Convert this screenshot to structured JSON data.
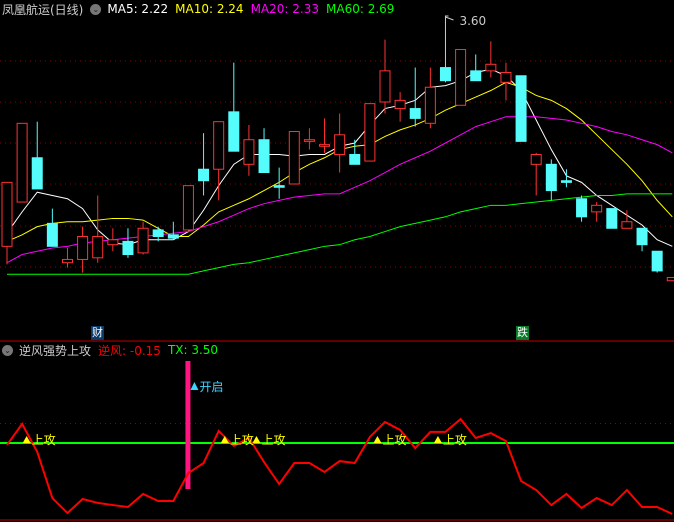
{
  "header": {
    "stock_title": "凤凰航运(日线)",
    "ma5": "MA5: 2.22",
    "ma10": "MA10: 2.24",
    "ma20": "MA20: 2.33",
    "ma60": "MA60: 2.69",
    "collapse_icon": "chevron-down-icon"
  },
  "high_marker": "3.60",
  "event_tags": {
    "cai": "财",
    "die": "跌"
  },
  "indicator": {
    "title": "逆风强势上攻",
    "nifeng": "逆风: -0.15",
    "tx": "TX: 3.50",
    "open_signal_label": "开启",
    "attack_label": "上攻"
  },
  "colors": {
    "up": "#ff3232",
    "down": "#54fcfc",
    "ma5": "#ffffff",
    "ma10": "#ffff00",
    "ma20": "#ff00ff",
    "ma60": "#00ff00",
    "grid": "#8b0000",
    "signal_bar": "#ff1480",
    "nifeng_line": "#ff0000",
    "tx_line": "#00ff00"
  },
  "chart_data": [
    {
      "type": "candlestick",
      "title": "凤凰航运(日线)",
      "ohlc": [
        [
          2.22,
          2.61,
          2.11,
          2.61
        ],
        [
          2.49,
          2.97,
          2.49,
          2.97
        ],
        [
          2.76,
          2.98,
          2.57,
          2.57
        ],
        [
          2.36,
          2.45,
          2.22,
          2.22
        ],
        [
          2.12,
          2.21,
          2.09,
          2.14
        ],
        [
          2.14,
          2.34,
          2.06,
          2.28
        ],
        [
          2.15,
          2.53,
          2.12,
          2.28
        ],
        [
          2.23,
          2.33,
          2.19,
          2.26
        ],
        [
          2.25,
          2.33,
          2.15,
          2.17
        ],
        [
          2.18,
          2.37,
          2.17,
          2.33
        ],
        [
          2.32,
          2.34,
          2.25,
          2.28
        ],
        [
          2.29,
          2.37,
          2.26,
          2.27
        ],
        [
          2.32,
          2.59,
          2.32,
          2.59
        ],
        [
          2.69,
          2.91,
          2.53,
          2.62
        ],
        [
          2.69,
          2.98,
          2.5,
          2.98
        ],
        [
          3.04,
          3.34,
          2.8,
          2.8
        ],
        [
          2.72,
          2.96,
          2.65,
          2.87
        ],
        [
          2.87,
          2.94,
          2.67,
          2.67
        ],
        [
          2.59,
          2.7,
          2.51,
          2.58
        ],
        [
          2.6,
          2.92,
          2.6,
          2.92
        ],
        [
          2.86,
          2.94,
          2.81,
          2.87
        ],
        [
          2.83,
          3.0,
          2.79,
          2.84
        ],
        [
          2.78,
          3.03,
          2.67,
          2.9
        ],
        [
          2.78,
          2.87,
          2.72,
          2.72
        ],
        [
          2.74,
          3.09,
          2.74,
          3.09
        ],
        [
          3.1,
          3.48,
          3.03,
          3.29
        ],
        [
          3.06,
          3.16,
          2.98,
          3.11
        ],
        [
          3.06,
          3.31,
          2.95,
          3.0
        ],
        [
          2.97,
          3.31,
          2.94,
          3.19
        ],
        [
          3.31,
          3.6,
          3.22,
          3.23
        ],
        [
          3.08,
          3.42,
          3.08,
          3.42
        ],
        [
          3.29,
          3.39,
          3.23,
          3.23
        ],
        [
          3.29,
          3.47,
          3.25,
          3.33
        ],
        [
          3.22,
          3.34,
          3.11,
          3.28
        ],
        [
          3.26,
          3.26,
          2.86,
          2.86
        ],
        [
          2.72,
          2.79,
          2.53,
          2.78
        ],
        [
          2.72,
          2.75,
          2.5,
          2.56
        ],
        [
          2.62,
          2.69,
          2.58,
          2.61
        ],
        [
          2.51,
          2.53,
          2.37,
          2.4
        ],
        [
          2.43,
          2.49,
          2.37,
          2.47
        ],
        [
          2.45,
          2.45,
          2.33,
          2.33
        ],
        [
          2.33,
          2.44,
          2.33,
          2.37
        ],
        [
          2.33,
          2.33,
          2.19,
          2.23
        ],
        [
          2.19,
          2.19,
          2.06,
          2.07
        ],
        [
          2.01,
          2.03,
          2.01,
          2.03
        ]
      ],
      "ma": {
        "MA5": [
          2.3,
          2.43,
          2.55,
          2.53,
          2.51,
          2.45,
          2.32,
          2.24,
          2.23,
          2.26,
          2.26,
          2.26,
          2.31,
          2.44,
          2.59,
          2.72,
          2.78,
          2.78,
          2.78,
          2.77,
          2.78,
          2.78,
          2.83,
          2.85,
          2.96,
          3.06,
          3.08,
          3.11,
          3.19,
          3.2,
          3.23,
          3.28,
          3.3,
          3.26,
          3.17,
          2.99,
          2.81,
          2.65,
          2.61,
          2.53,
          2.47,
          2.41,
          2.35,
          2.26,
          2.22
        ],
        "MA10": [
          2.25,
          2.29,
          2.34,
          2.36,
          2.37,
          2.37,
          2.38,
          2.39,
          2.39,
          2.38,
          2.33,
          2.28,
          2.28,
          2.35,
          2.43,
          2.47,
          2.51,
          2.56,
          2.61,
          2.67,
          2.72,
          2.76,
          2.81,
          2.83,
          2.84,
          2.89,
          2.93,
          2.96,
          3.0,
          3.05,
          3.09,
          3.13,
          3.17,
          3.22,
          3.19,
          3.14,
          3.11,
          3.06,
          2.99,
          2.9,
          2.81,
          2.72,
          2.62,
          2.5,
          2.4
        ],
        "MA20": [
          2.12,
          2.17,
          2.19,
          2.21,
          2.22,
          2.24,
          2.25,
          2.26,
          2.27,
          2.28,
          2.29,
          2.3,
          2.31,
          2.34,
          2.37,
          2.41,
          2.45,
          2.48,
          2.5,
          2.52,
          2.53,
          2.54,
          2.54,
          2.58,
          2.62,
          2.67,
          2.72,
          2.76,
          2.8,
          2.85,
          2.9,
          2.95,
          2.98,
          3.01,
          3.01,
          3.01,
          3.0,
          2.99,
          2.97,
          2.95,
          2.92,
          2.9,
          2.87,
          2.84,
          2.79
        ],
        "MA60": [
          2.05,
          2.05,
          2.05,
          2.05,
          2.05,
          2.05,
          2.05,
          2.05,
          2.05,
          2.05,
          2.05,
          2.05,
          2.05,
          2.07,
          2.09,
          2.11,
          2.12,
          2.14,
          2.16,
          2.18,
          2.2,
          2.22,
          2.23,
          2.26,
          2.28,
          2.31,
          2.34,
          2.36,
          2.38,
          2.4,
          2.43,
          2.45,
          2.47,
          2.47,
          2.48,
          2.49,
          2.5,
          2.51,
          2.52,
          2.53,
          2.53,
          2.54,
          2.54,
          2.54,
          2.54
        ]
      },
      "high_index": 29,
      "cai_index": 6,
      "die_index": 34
    },
    {
      "type": "line",
      "title": "逆风强势上攻",
      "nifeng": [
        3.4,
        4.48,
        3.04,
        0.67,
        -0.1,
        0.62,
        0.42,
        0.31,
        0.21,
        0.88,
        0.52,
        0.52,
        1.96,
        2.47,
        4.12,
        3.35,
        3.76,
        2.52,
        1.39,
        2.47,
        2.47,
        2.01,
        2.57,
        2.47,
        3.81,
        4.58,
        4.17,
        3.24,
        4.07,
        4.07,
        4.73,
        3.76,
        4.01,
        3.6,
        1.55,
        1.08,
        0.31,
        0.88,
        0.16,
        0.67,
        0.31,
        1.08,
        0.21,
        0.21,
        -0.15
      ],
      "tx": 3.5,
      "reference_level": 4.5,
      "open_signal_index": 12,
      "attack_signal_indices": [
        1.3,
        14.4,
        16.5,
        24.5,
        28.5
      ]
    }
  ]
}
